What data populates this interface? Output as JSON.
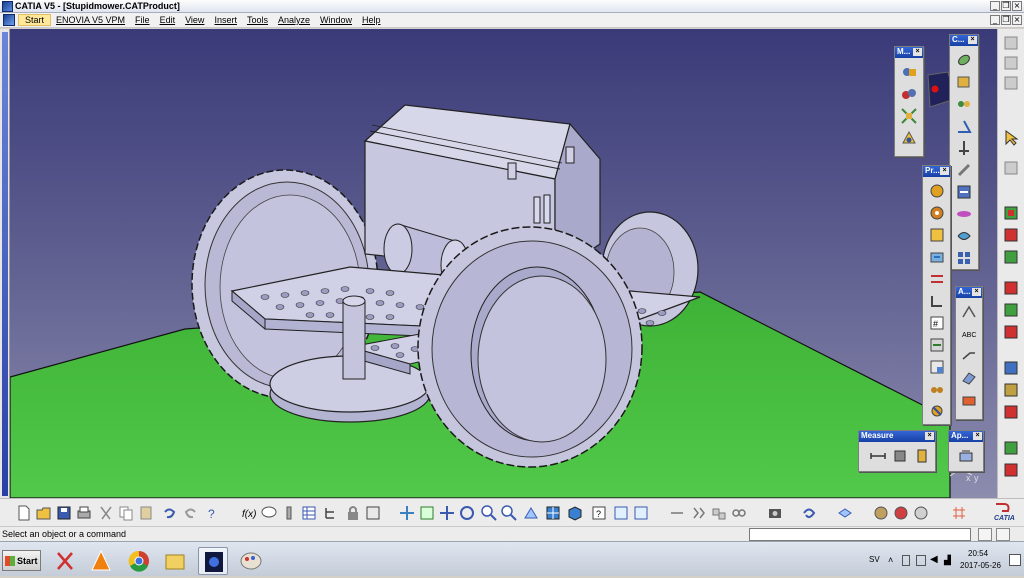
{
  "window": {
    "title": "CATIA V5 - [Stupidmower.CATProduct]"
  },
  "menu": {
    "items": [
      "Start",
      "ENOVIA V5 VPM",
      "File",
      "Edit",
      "View",
      "Insert",
      "Tools",
      "Analyze",
      "Window",
      "Help"
    ]
  },
  "toolbars": {
    "measure_title": "Measure",
    "m_title": "M...",
    "c_title": "C...",
    "pr_title": "Pr...",
    "a_title": "A...",
    "ap_title": "Ap..."
  },
  "compass": {
    "x_label": "x",
    "y_label": "y"
  },
  "brand": {
    "logo_text": "CATIA"
  },
  "status": {
    "message": "Select an object or a command",
    "command_value": ""
  },
  "taskbar": {
    "start_label": "Start",
    "language": "SV",
    "time": "20:54",
    "date": "2017-05-26"
  },
  "colors": {
    "viewport_top": "#3a3a79",
    "viewport_bottom": "#8c8caf",
    "ground": "#43bc3c",
    "part": "#c9c9e1",
    "part_shade": "#a3a3c8",
    "toolbar_title": "#2554c7"
  }
}
